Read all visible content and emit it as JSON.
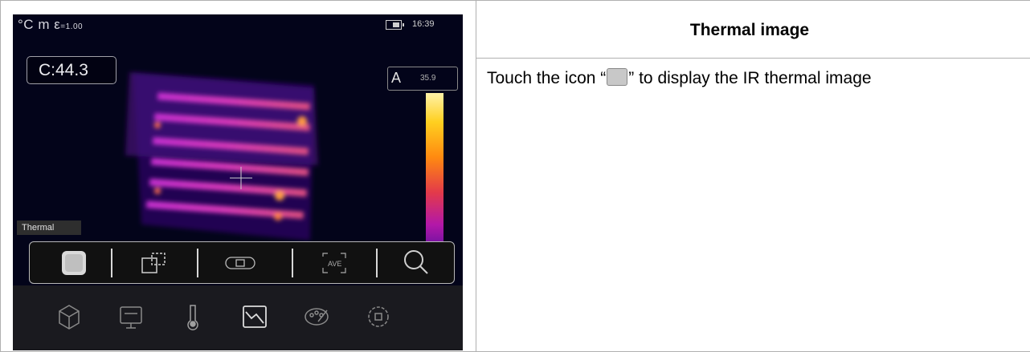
{
  "device": {
    "status": {
      "unit": "°C",
      "emissivity_label": "m ε",
      "emissivity_value": "=1.00",
      "time": "16:39"
    },
    "readout": "C:44.3",
    "scale": {
      "mode": "A",
      "value": "35.9"
    },
    "mode_label": "Thermal",
    "toolbar_top": [
      {
        "name": "thermal-image-icon",
        "selected": true
      },
      {
        "name": "picture-in-picture-icon"
      },
      {
        "name": "blend-icon"
      },
      {
        "name": "visual-image-icon",
        "text": "AVE"
      },
      {
        "name": "zoom-icon"
      }
    ],
    "toolbar_bottom": [
      {
        "name": "cube-icon"
      },
      {
        "name": "display-icon"
      },
      {
        "name": "thermometer-icon"
      },
      {
        "name": "image-mode-icon",
        "selected": true
      },
      {
        "name": "palette-icon"
      },
      {
        "name": "settings-icon"
      }
    ]
  },
  "doc": {
    "heading": "Thermal image",
    "text_before": "Touch the icon “",
    "text_after": "” to display the IR thermal image"
  }
}
